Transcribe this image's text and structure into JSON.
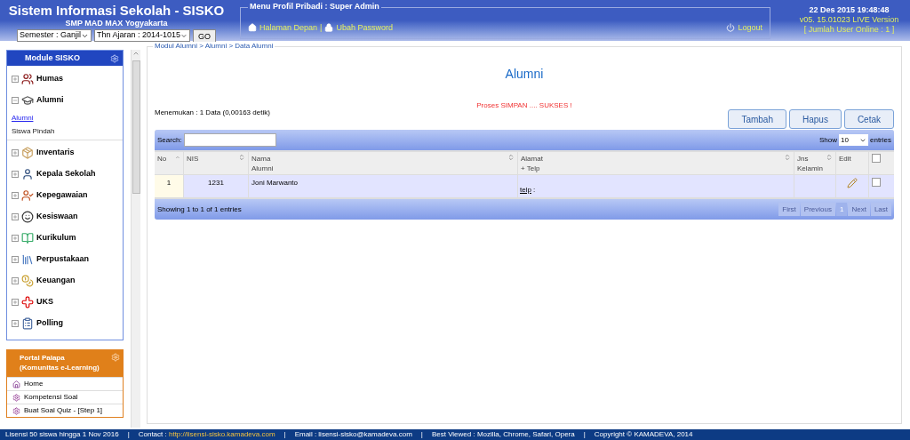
{
  "header": {
    "title": "Sistem Informasi Sekolah - SISKO",
    "school": "SMP MAD MAX Yogyakarta",
    "semester": "Semester : Ganjil",
    "year": "Thn Ajaran : 2014-1015",
    "go": "GO",
    "profile_legend": "Menu Profil Pribadi : Super Admin",
    "home_link": "Halaman Depan",
    "separator": "|",
    "password_link": "Ubah Password",
    "logout": "Logout",
    "datetime": "22 Des 2015 19:48:48",
    "version": "v05. 15.01023 LIVE Version",
    "online": "[ Jumlah User Online : 1 ]"
  },
  "sidebar": {
    "module_title": "Module SISKO",
    "modules": [
      {
        "label": "Humas",
        "expanded": false
      },
      {
        "label": "Alumni",
        "expanded": true,
        "children": [
          {
            "label": "Alumni",
            "selected": true
          },
          {
            "label": "Siswa Pindah",
            "selected": false
          }
        ]
      },
      {
        "label": "Inventaris",
        "expanded": false
      },
      {
        "label": "Kepala Sekolah",
        "expanded": false
      },
      {
        "label": "Kepegawaian",
        "expanded": false
      },
      {
        "label": "Kesiswaan",
        "expanded": false
      },
      {
        "label": "Kurikulum",
        "expanded": false
      },
      {
        "label": "Perpustakaan",
        "expanded": false
      },
      {
        "label": "Keuangan",
        "expanded": false
      },
      {
        "label": "UKS",
        "expanded": false
      },
      {
        "label": "Polling",
        "expanded": false
      }
    ],
    "portal_title": "Portal Palapa",
    "portal_subtitle": "(Komunitas e-Learning)",
    "portal_items": [
      "Home",
      "Kompetensi Soal",
      "Buat Soal Quiz - [Step 1]"
    ]
  },
  "content": {
    "breadcrumb": "Modul Alumni > Alumni > Data Alumni",
    "heading": "Alumni",
    "message": "Proses SIMPAN .... SUKSES !",
    "found": "Menemukan : 1 Data (0,00163 detik)",
    "buttons": [
      "Tambah",
      "Hapus",
      "Cetak"
    ],
    "search_label": "Search:",
    "show_label": "Show",
    "show_value": "10",
    "entries_label": "entries",
    "columns": [
      {
        "label": "No",
        "kind": "text"
      },
      {
        "label": "NIS",
        "kind": "text"
      },
      {
        "label": "Nama Alumni",
        "kind": "text"
      },
      {
        "label": "Alamat + Telp",
        "kind": "text"
      },
      {
        "label": "Jns Kelamin",
        "kind": "text"
      },
      {
        "label": "Edit",
        "kind": "text"
      },
      {
        "kind": "checkbox",
        "checked": false
      }
    ],
    "rows": [
      {
        "no": "1",
        "nis": "1231",
        "nama": "Joni Marwanto",
        "telp_link": "telp",
        "telp_suffix": ":",
        "checked": false
      }
    ],
    "info": "Showing 1 to 1 of 1 entries",
    "pages": [
      {
        "label": "First",
        "disabled": true,
        "selected": false
      },
      {
        "label": "Previous",
        "disabled": true,
        "selected": false
      },
      {
        "label": "1",
        "disabled": false,
        "selected": true
      },
      {
        "label": "Next",
        "disabled": true,
        "selected": false
      },
      {
        "label": "Last",
        "disabled": true,
        "selected": false
      }
    ]
  },
  "footer": [
    "Lisensi 50 siswa hingga 1 Nov 2016",
    "|",
    "Contact : ",
    "http://lisensi-sisko.kamadeva.com",
    "|",
    "Email : lisensi-sisko@kamadeva.com",
    "|",
    "Best Viewed : Mozilla, Chrome, Safari, Opera",
    "|",
    "Copyright © KAMADEVA, 2014"
  ]
}
